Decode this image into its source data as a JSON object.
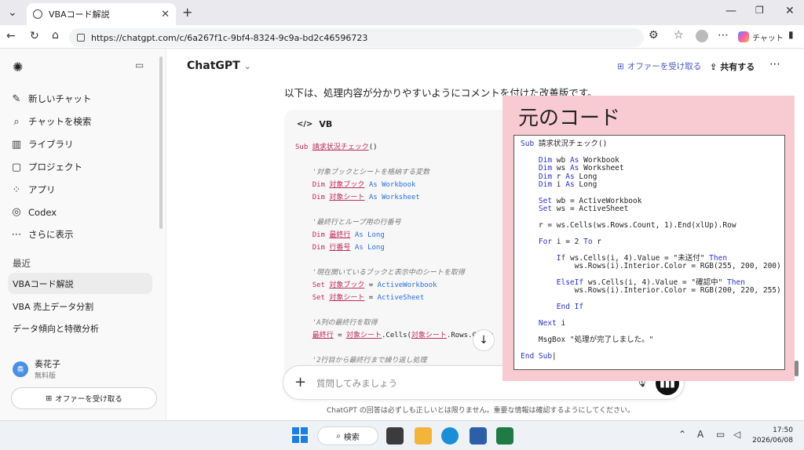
{
  "browser": {
    "tab_title": "VBAコード解説",
    "url": "https://chatgpt.com/c/6a267f1c-9bf4-8324-9c9a-bd2c46596723",
    "copilot_label": "チャット"
  },
  "sidebar": {
    "items": [
      {
        "icon": "edit-icon",
        "label": "新しいチャット"
      },
      {
        "icon": "search-icon",
        "label": "チャットを検索"
      },
      {
        "icon": "library-icon",
        "label": "ライブラリ"
      },
      {
        "icon": "folder-icon",
        "label": "プロジェクト"
      },
      {
        "icon": "apps-icon",
        "label": "アプリ"
      },
      {
        "icon": "codex-icon",
        "label": "Codex"
      },
      {
        "icon": "more-icon",
        "label": "さらに表示"
      }
    ],
    "recent_label": "最近",
    "recent": [
      "VBAコード解説",
      "VBA 売上データ分割",
      "データ傾向と特徴分析"
    ],
    "user": {
      "initial": "奏",
      "name": "奏花子",
      "plan": "無料版"
    },
    "offer_label": "オファーを受け取る"
  },
  "header": {
    "model": "ChatGPT",
    "offer_label": "オファーを受け取る",
    "share_label": "共有する"
  },
  "message": {
    "intro": "以下は、処理内容が分かりやすいようにコメントを付けた改善版です。",
    "code_lang": "VB"
  },
  "composer": {
    "placeholder": "質問してみましょう"
  },
  "disclaimer": "ChatGPT の回答は必ずしも正しいとは限りません。重要な情報は確認するようにしてください。",
  "overlay": {
    "title": "元のコード"
  },
  "taskbar": {
    "search_label": "検索",
    "time": "17:50",
    "date": "2026/06/08"
  },
  "colors": {
    "overlay_bg": "#f8cbd2",
    "accent": "#4a56c8",
    "vb_keyword": "#c02d5e"
  }
}
